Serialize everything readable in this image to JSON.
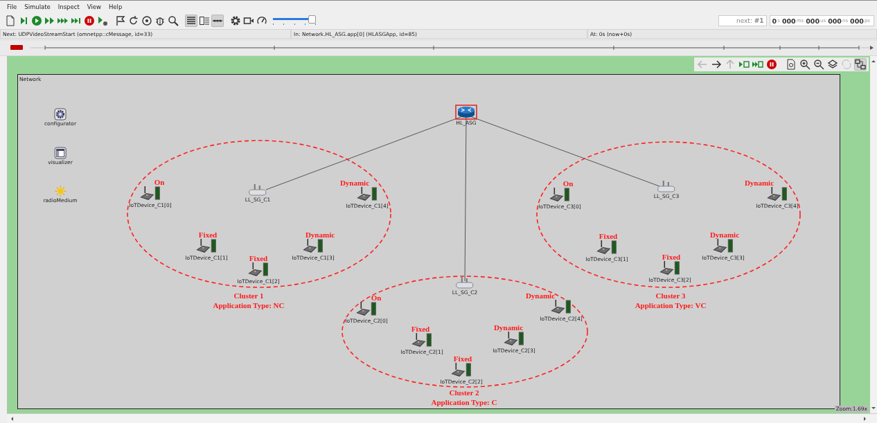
{
  "menu": [
    "File",
    "Simulate",
    "Inspect",
    "View",
    "Help"
  ],
  "toolbar": [
    {
      "kind": "new",
      "on": false
    },
    {
      "kind": "step",
      "on": false
    },
    {
      "kind": "run",
      "on": false
    },
    {
      "kind": "fast",
      "on": false
    },
    {
      "kind": "express",
      "on": false
    },
    {
      "kind": "until",
      "on": false
    },
    {
      "kind": "stop",
      "on": false
    },
    {
      "kind": "debug-next",
      "on": false
    },
    {
      "kind": "sep"
    },
    {
      "kind": "flag",
      "on": false
    },
    {
      "kind": "rebuild",
      "on": false
    },
    {
      "kind": "target",
      "on": false
    },
    {
      "kind": "bug",
      "on": false
    },
    {
      "kind": "search",
      "on": false
    },
    {
      "kind": "sep"
    },
    {
      "kind": "list",
      "on": true
    },
    {
      "kind": "details",
      "on": false
    },
    {
      "kind": "timeline",
      "on": true
    },
    {
      "kind": "sep"
    },
    {
      "kind": "gear",
      "on": false
    },
    {
      "kind": "camera",
      "on": false
    },
    {
      "kind": "gauge",
      "on": false
    }
  ],
  "speed_slider": {
    "level": 1
  },
  "event_number": "next: **#1**",
  "sim_time": [
    {
      "value": "0",
      "unit": "s"
    },
    {
      "value": "000",
      "unit": "ms"
    },
    {
      "value": "000",
      "unit": "us"
    },
    {
      "value": "000",
      "unit": "ns"
    },
    {
      "value": "000",
      "unit": "ps"
    }
  ],
  "status_bar": [
    "Next: UDPVideoStreamStart (omnetpp::cMessage, id=33)",
    "In: Network.HL_ASG.app[0] (HLASGApp, id=85)",
    "At: 0s (now+0s)"
  ],
  "canvas_toolbar": [
    {
      "kind": "back",
      "disabled": true,
      "on": false
    },
    {
      "kind": "forward",
      "disabled": false,
      "on": false
    },
    {
      "kind": "up",
      "disabled": true,
      "on": false
    },
    {
      "kind": "run-local",
      "disabled": false,
      "on": false
    },
    {
      "kind": "fast-local",
      "disabled": false,
      "on": false
    },
    {
      "kind": "stop",
      "disabled": false,
      "on": false
    },
    {
      "kind": "sep"
    },
    {
      "kind": "relayout",
      "disabled": false,
      "on": false
    },
    {
      "kind": "zoom-in",
      "disabled": false,
      "on": false
    },
    {
      "kind": "zoom-out",
      "disabled": false,
      "on": false
    },
    {
      "kind": "layers",
      "disabled": false,
      "on": false
    },
    {
      "kind": "perspective",
      "disabled": true,
      "on": false
    },
    {
      "kind": "module-view",
      "disabled": false,
      "on": true
    }
  ],
  "network": {
    "title": "Network",
    "modules": [
      {
        "kind": "configurator",
        "name": "configurator"
      },
      {
        "kind": "visualizer",
        "name": "visualizer"
      },
      {
        "kind": "radio",
        "name": "radioMedium"
      }
    ],
    "router": {
      "name": "HL_ASG",
      "selected": true
    },
    "clusters": [
      {
        "title": "Cluster 1",
        "app_type": "Application Type: NC",
        "gateway": "LL_SG_C1",
        "devices": [
          {
            "name": "IoTDevice_C1[0]",
            "mode": "On"
          },
          {
            "name": "IoTDevice_C1[1]",
            "mode": "Fixed"
          },
          {
            "name": "IoTDevice_C1[2]",
            "mode": "Fixed"
          },
          {
            "name": "IoTDevice_C1[3]",
            "mode": "Dynamic"
          },
          {
            "name": "IoTDevice_C1[4]",
            "mode": "Dynamic"
          }
        ]
      },
      {
        "title": "Cluster 2",
        "app_type": "Application Type: C",
        "gateway": "LL_SG_C2",
        "devices": [
          {
            "name": "IoTDevice_C2[0]",
            "mode": "On"
          },
          {
            "name": "IoTDevice_C2[1]",
            "mode": "Fixed"
          },
          {
            "name": "IoTDevice_C2[2]",
            "mode": "Fixed"
          },
          {
            "name": "IoTDevice_C2[3]",
            "mode": "Dynamic"
          },
          {
            "name": "IoTDevice_C2[4]",
            "mode": "Dynamic"
          }
        ]
      },
      {
        "title": "Cluster 3",
        "app_type": "Application Type: VC",
        "gateway": "LL_SG_C3",
        "devices": [
          {
            "name": "IoTDevice_C3[0]",
            "mode": "On"
          },
          {
            "name": "IoTDevice_C3[1]",
            "mode": "Fixed"
          },
          {
            "name": "IoTDevice_C3[2]",
            "mode": "Fixed"
          },
          {
            "name": "IoTDevice_C3[3]",
            "mode": "Dynamic"
          },
          {
            "name": "IoTDevice_C3[4]",
            "mode": "Dynamic"
          }
        ]
      }
    ]
  },
  "zoom": "Zoom:1.69x"
}
